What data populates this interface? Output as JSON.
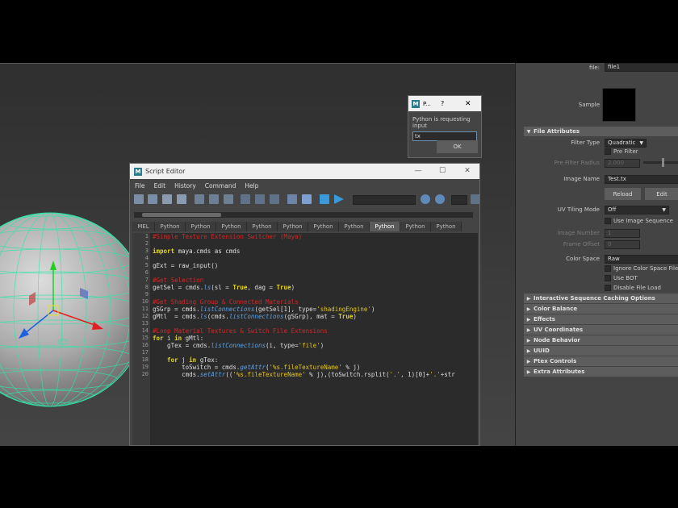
{
  "attribute_editor": {
    "file_field_label": "file:",
    "file_field_value": "file1",
    "sample_label": "Sample",
    "file_attributes_section": "File Attributes",
    "filter_type_label": "Filter Type",
    "filter_type_value": "Quadratic",
    "pre_filter_label": "Pre Filter",
    "pre_filter_radius_label": "Pre Filter Radius",
    "pre_filter_radius_value": "2.000",
    "image_name_label": "Image Name",
    "image_name_value": "Test.tx",
    "reload_button": "Reload",
    "edit_button": "Edit",
    "uv_tiling_mode_label": "UV Tiling Mode",
    "uv_tiling_mode_value": "Off",
    "use_image_sequence_label": "Use Image Sequence",
    "image_number_label": "Image Number",
    "image_number_value": "1",
    "frame_offset_label": "Frame Offset",
    "frame_offset_value": "0",
    "color_space_label": "Color Space",
    "color_space_value": "Raw",
    "ignore_color_space_label": "Ignore Color Space File Ru",
    "use_bot_label": "Use BOT",
    "disable_file_load_label": "Disable File Load",
    "sections": [
      "Interactive Sequence Caching Options",
      "Color Balance",
      "Effects",
      "UV Coordinates",
      "Node Behavior",
      "UUID",
      "Ptex Controls",
      "Extra Attributes"
    ]
  },
  "python_dialog": {
    "title": "P...",
    "help": "?",
    "close": "✕",
    "prompt": "Python is requesting input",
    "input_value": "tx",
    "ok_button": "OK"
  },
  "script_editor": {
    "title": "Script Editor",
    "logo": "M",
    "minimize": "—",
    "maximize": "☐",
    "close": "✕",
    "menu": [
      "File",
      "Edit",
      "History",
      "Command",
      "Help"
    ],
    "tabs": [
      "MEL",
      "Python",
      "Python",
      "Python",
      "Python",
      "Python",
      "Python",
      "Python",
      "Python",
      "Python",
      "Python"
    ],
    "active_tab_index": 8,
    "line_numbers": [
      "1",
      "2",
      "3",
      "4",
      "5",
      "6",
      "7",
      "8",
      "9",
      "10",
      "11",
      "12",
      "13",
      "14",
      "15",
      "16",
      "17",
      "18",
      "19",
      "20"
    ],
    "code": {
      "l1": "#Simple Texture Extension Switcher (Maya)",
      "l3a": "import",
      "l3b": " maya.cmds as cmds",
      "l5": "gExt = raw_input()",
      "l7": "#Get Selection",
      "l8a": "getSel = cmds.",
      "l8b": "ls",
      "l8c": "(sl = ",
      "l8d": "True",
      "l8e": ", dag = ",
      "l8f": "True",
      "l8g": ")",
      "l10": "#Get Shading Group & Connected Materials",
      "l11a": "gSGrp = cmds.",
      "l11b": "listConnections",
      "l11c": "(getSel[1], type=",
      "l11d": "'shadingEngine'",
      "l11e": ")",
      "l12a": "gMtl  = cmds.",
      "l12b": "ls",
      "l12c": "(cmds.",
      "l12d": "listConnections",
      "l12e": "(gSGrp), mat = ",
      "l12f": "True",
      "l12g": ")",
      "l14": "#Loop Material Textures & Switch File Extensions",
      "l15a": "for",
      "l15b": " i ",
      "l15c": "in",
      "l15d": " gMtl:",
      "l16a": "    gTex = cmds.",
      "l16b": "listConnections",
      "l16c": "(i, type=",
      "l16d": "'file'",
      "l16e": ")",
      "l18a": "    for",
      "l18b": " j ",
      "l18c": "in",
      "l18d": " gTex:",
      "l19a": "        toSwitch = cmds.",
      "l19b": "getAttr",
      "l19c": "(",
      "l19d": "'%s.fileTextureName'",
      "l19e": " % j)",
      "l20a": "        cmds.",
      "l20b": "setAttr",
      "l20c": "((",
      "l20d": "'%s.fileTextureName'",
      "l20e": " % j),(toSwitch.rsplit(",
      "l20f": "'.'",
      "l20g": ", 1)[0]+",
      "l20h": "'.'",
      "l20i": "+str"
    }
  },
  "colors": {
    "wireframe": "#2fe5a8",
    "comment": "#d02828",
    "keyword": "#e4d51b",
    "function": "#5ea1e3"
  },
  "icons": {
    "sphere": "polygon-sphere-wireframe",
    "move_manipulator": "move-tool-manipulator"
  }
}
